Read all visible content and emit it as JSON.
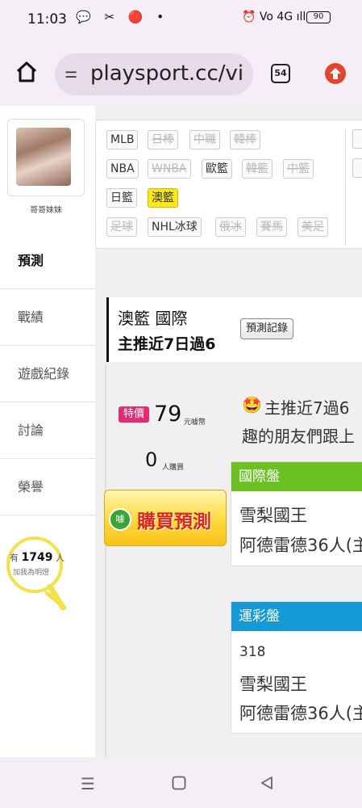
{
  "status_bar": {
    "time": "11:03",
    "left_icons": "💬 ✂ 🔴 •",
    "right_icons": "⏰ Vo 4G ıll",
    "battery": "90"
  },
  "browser": {
    "url": "playsport.cc/vi",
    "tab_count": "54"
  },
  "profile": {
    "nickname": "哥哥妹妹"
  },
  "sidebar": {
    "items": [
      {
        "label": "預測"
      },
      {
        "label": "戰績"
      },
      {
        "label": "遊戲紀錄"
      },
      {
        "label": "討論"
      },
      {
        "label": "榮譽"
      }
    ],
    "lamp": {
      "prefix": "有",
      "count": "1749",
      "suffix": "人",
      "caption": "加我為明燈"
    }
  },
  "sports": {
    "row1": [
      "MLB",
      "日棒",
      "中職",
      "韓棒"
    ],
    "row2": [
      "NBA",
      "WNBA",
      "歐籃",
      "韓籃",
      "中籃"
    ],
    "row3": [
      "日籃",
      "澳籃"
    ],
    "row4": [
      "足球",
      "NHL冰球",
      "俄冰",
      "賽馬",
      "美足"
    ],
    "selected": "澳籃"
  },
  "header": {
    "title": "澳籃 國際",
    "subtitle": "主推近7日過6",
    "record_button": "預測記錄"
  },
  "purchase": {
    "badge": "特價",
    "price": "79",
    "price_unit": "元噱幣",
    "buyers": "0",
    "buyers_unit": "人購買",
    "buy_button": "購買預測",
    "coin_label": "噱"
  },
  "description": {
    "emoji": "🤩",
    "line1": "主推近7過6",
    "line2": "趣的朋友們跟上"
  },
  "boards": {
    "international": {
      "title": "國際盤",
      "lines": [
        "雪梨國王",
        "阿德雷德36人(主"
      ]
    },
    "lottery": {
      "title": "運彩盤",
      "code": "318",
      "lines": [
        "雪梨國王",
        "阿德雷德36人(主"
      ]
    }
  },
  "colors": {
    "accent_yellow": "#ffe81a",
    "intl_green": "#6cc024",
    "lottery_blue": "#149ad6",
    "promo_pink": "#e42a72",
    "buy_red": "#d72a1a"
  }
}
